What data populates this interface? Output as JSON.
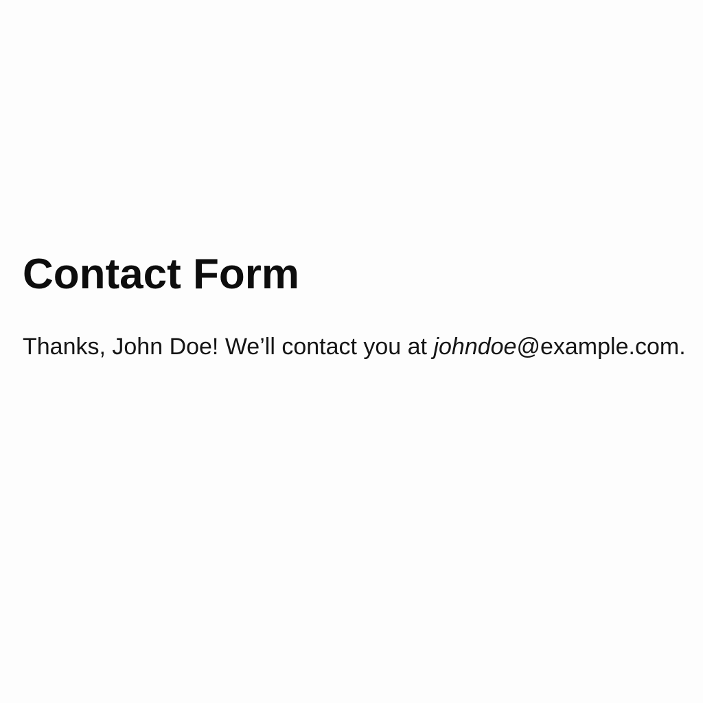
{
  "page": {
    "title": "Contact Form"
  },
  "confirmation": {
    "prefix": "Thanks, John Doe! We’ll contact you at ",
    "email_user": "johndoe",
    "email_domain": "@example.com",
    "suffix": "."
  },
  "colors": {
    "background": "#fdfdfd",
    "text": "#111111"
  }
}
